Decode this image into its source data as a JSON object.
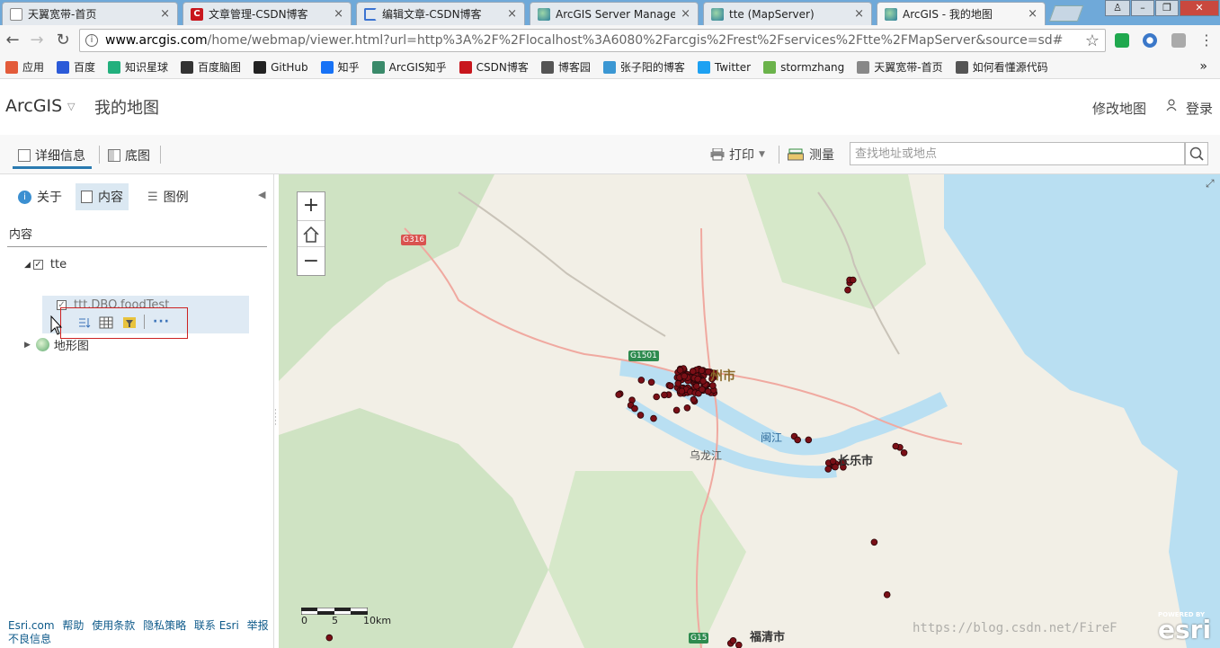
{
  "browser": {
    "tabs": [
      {
        "title": "天翼宽带-首页",
        "icon": "document-icon",
        "active": false
      },
      {
        "title": "文章管理-CSDN博客",
        "icon": "csdn-icon",
        "active": false
      },
      {
        "title": "编辑文章-CSDN博客",
        "icon": "loading-icon",
        "active": false
      },
      {
        "title": "ArcGIS Server Manager",
        "icon": "globe-icon",
        "active": false
      },
      {
        "title": "tte (MapServer)",
        "icon": "globe-icon",
        "active": false
      },
      {
        "title": "ArcGIS - 我的地图",
        "icon": "globe-icon",
        "active": true
      }
    ],
    "url_host": "www.arcgis.com",
    "url_rest": "/home/webmap/viewer.html?url=http%3A%2F%2Flocalhost%3A6080%2Farcgis%2Frest%2Fservices%2Ftte%2FMapServer&source=sd#",
    "bookmarks": [
      {
        "label": "应用",
        "icon": "apps-grid-icon",
        "color": "#e35b3a"
      },
      {
        "label": "百度",
        "icon": "baidu-paw-icon",
        "color": "#2b5ad8"
      },
      {
        "label": "知识星球",
        "icon": "circle-icon",
        "color": "#22b07d"
      },
      {
        "label": "百度脑图",
        "icon": "owl-icon",
        "color": "#333333"
      },
      {
        "label": "GitHub",
        "icon": "github-icon",
        "color": "#222222"
      },
      {
        "label": "知乎",
        "icon": "zhihu-icon",
        "color": "#1772f6"
      },
      {
        "label": "ArcGIS知乎",
        "icon": "globe-icon",
        "color": "#3a8a6a"
      },
      {
        "label": "CSDN博客",
        "icon": "csdn-icon",
        "color": "#c8161d"
      },
      {
        "label": "博客园",
        "icon": "cnblogs-icon",
        "color": "#555555"
      },
      {
        "label": "张子阳的博客",
        "icon": "k-icon",
        "color": "#3b97d3"
      },
      {
        "label": "Twitter",
        "icon": "twitter-icon",
        "color": "#1da1f2"
      },
      {
        "label": "stormzhang",
        "icon": "leaf-icon",
        "color": "#6bb34b"
      },
      {
        "label": "天翼宽带-首页",
        "icon": "document-icon",
        "color": "#888888"
      },
      {
        "label": "如何看懂源代码",
        "icon": "cnblogs-icon",
        "color": "#555555"
      }
    ],
    "more": "»"
  },
  "header": {
    "brand": "ArcGIS",
    "map_title": "我的地图",
    "modify_map": "修改地图",
    "login": "登录"
  },
  "toolbar": {
    "details_tab": "详细信息",
    "basemap_tab": "底图",
    "print": "打印",
    "measure": "测量",
    "search_placeholder": "查找地址或地点"
  },
  "panel": {
    "tabs": {
      "about": "关于",
      "content": "内容",
      "legend": "图例"
    },
    "heading": "内容",
    "layers": {
      "group": "tte",
      "sublayer": "ttt.DBO.foodTest",
      "basemap": "地形图"
    },
    "footer_links": [
      "Esri.com",
      "帮助",
      "使用条款",
      "隐私策略",
      "联系 Esri",
      "举报不良信息"
    ]
  },
  "map": {
    "labels": {
      "city_fuzhou": "州市",
      "river_min": "闽江",
      "river_wulong": "乌龙江",
      "city_changle": "长乐市",
      "city_fuqing": "福清市",
      "hw_g316": "G316",
      "hw_g1501": "G1501",
      "hw_g15": "G15"
    },
    "scale": {
      "zero": "0",
      "mid": "5",
      "end": "10km"
    },
    "esri_powered": "POWERED BY",
    "esri_logo": "esri",
    "watermark": "https://blog.csdn.net/FireF",
    "colors": {
      "water": "#b9dff2",
      "land": "#f2efe6",
      "point": "#7a0f16",
      "road": "#f0a9a0"
    }
  }
}
